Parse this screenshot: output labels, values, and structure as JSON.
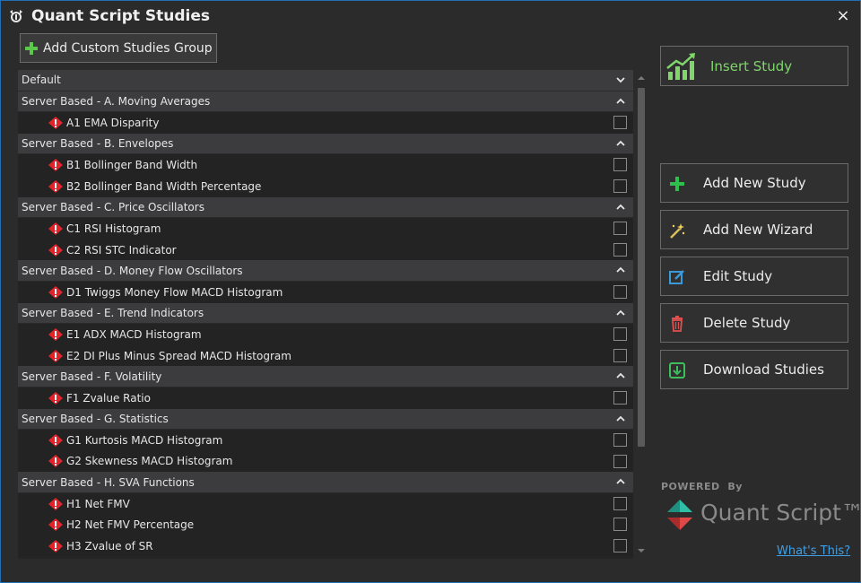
{
  "window": {
    "title": "Quant Script Studies",
    "close_label": "×"
  },
  "toolbar": {
    "add_group_label": "Add Custom Studies Group"
  },
  "list": {
    "groups": [
      {
        "label": "Default",
        "chevron": "down",
        "items": []
      },
      {
        "label": "Server Based - A. Moving Averages",
        "chevron": "up",
        "items": [
          {
            "label": "A1 EMA Disparity",
            "checked": false
          }
        ]
      },
      {
        "label": "Server Based - B. Envelopes",
        "chevron": "up",
        "items": [
          {
            "label": "B1 Bollinger Band Width",
            "checked": false
          },
          {
            "label": "B2 Bollinger Band Width Percentage",
            "checked": false
          }
        ]
      },
      {
        "label": "Server Based - C. Price Oscillators",
        "chevron": "up",
        "items": [
          {
            "label": "C1 RSI Histogram",
            "checked": false
          },
          {
            "label": "C2 RSI STC Indicator",
            "checked": false
          }
        ]
      },
      {
        "label": "Server Based - D. Money Flow Oscillators",
        "chevron": "up",
        "items": [
          {
            "label": "D1 Twiggs Money Flow MACD Histogram",
            "checked": false
          }
        ]
      },
      {
        "label": "Server Based - E. Trend Indicators",
        "chevron": "up",
        "items": [
          {
            "label": "E1 ADX MACD Histogram",
            "checked": false
          },
          {
            "label": "E2 DI Plus Minus Spread MACD Histogram",
            "checked": false
          }
        ]
      },
      {
        "label": "Server Based - F. Volatility",
        "chevron": "up",
        "items": [
          {
            "label": "F1 Zvalue Ratio",
            "checked": false
          }
        ]
      },
      {
        "label": "Server Based - G. Statistics",
        "chevron": "up",
        "items": [
          {
            "label": "G1 Kurtosis MACD Histogram",
            "checked": false
          },
          {
            "label": "G2 Skewness MACD Histogram",
            "checked": false
          }
        ]
      },
      {
        "label": "Server Based - H. SVA Functions",
        "chevron": "up",
        "items": [
          {
            "label": "H1 Net FMV",
            "checked": false
          },
          {
            "label": "H2 Net FMV Percentage",
            "checked": false
          },
          {
            "label": "H3 Zvalue of SR",
            "checked": false
          }
        ]
      }
    ]
  },
  "actions": {
    "insert_study": "Insert Study",
    "add_new_study": "Add New Study",
    "add_new_wizard": "Add New Wizard",
    "edit_study": "Edit Study",
    "delete_study": "Delete Study",
    "download_studies": "Download Studies"
  },
  "footer": {
    "powered_by": "POWERED  By",
    "brand": "Quant Script™",
    "whats_this": "What's This?"
  },
  "colors": {
    "accent_green": "#7fd66b",
    "warning_red": "#e0242b",
    "link_blue": "#3fa0e8",
    "window_border": "#1f6fb2"
  }
}
